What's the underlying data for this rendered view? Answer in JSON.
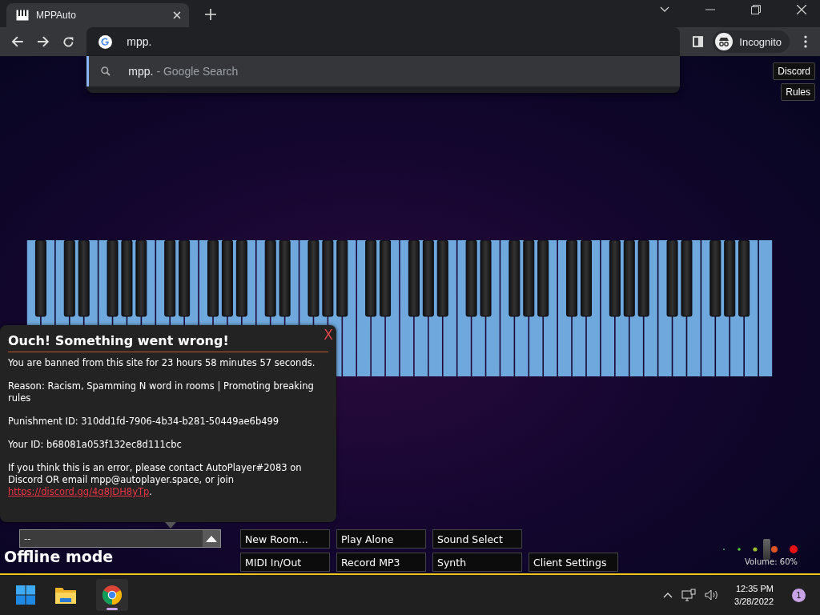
{
  "browser": {
    "tab": {
      "title": "MPPAuto"
    },
    "address": {
      "value": "mpp."
    },
    "suggestion": {
      "query": "mpp.",
      "hint": "- Google Search"
    },
    "profile": {
      "label": "Incognito"
    }
  },
  "page": {
    "links": [
      "Discord",
      "Rules"
    ],
    "error": {
      "title": "Ouch! Something went wrong!",
      "close": "X",
      "paragraphs": [
        {
          "text": "You are banned from this site for 23 hours 58 minutes 57 seconds."
        },
        {
          "text": "Reason: Racism, Spamming N word in rooms | Promoting breaking rules"
        },
        {
          "text": "Punishment ID: 310dd1fd-7906-4b34-b281-50449ae6b499"
        },
        {
          "text": "Your ID: b68081a053f132ec8d111cbc"
        },
        {
          "text": "If you think this is an error, please contact AutoPlayer#2083 on Discord OR email mpp@autoplayer.space, or join",
          "link": "https://discord.gg/4g8JDH8yTp",
          "after": "."
        }
      ]
    },
    "room_select": {
      "value": "--"
    },
    "status": "Offline mode",
    "buttons": [
      [
        "New Room...",
        "Play Alone",
        "Sound Select"
      ],
      [
        "MIDI In/Out",
        "Record MP3",
        "Synth",
        "Client Settings"
      ]
    ],
    "volume": {
      "label": "Volume: 60%",
      "level": 0.6
    }
  },
  "taskbar": {
    "apps": [
      {
        "kind": "explorer",
        "selected": false
      },
      {
        "kind": "chrome",
        "selected": true
      }
    ],
    "time": "12:35 PM",
    "date": "3/28/2022",
    "notifications": "1"
  }
}
